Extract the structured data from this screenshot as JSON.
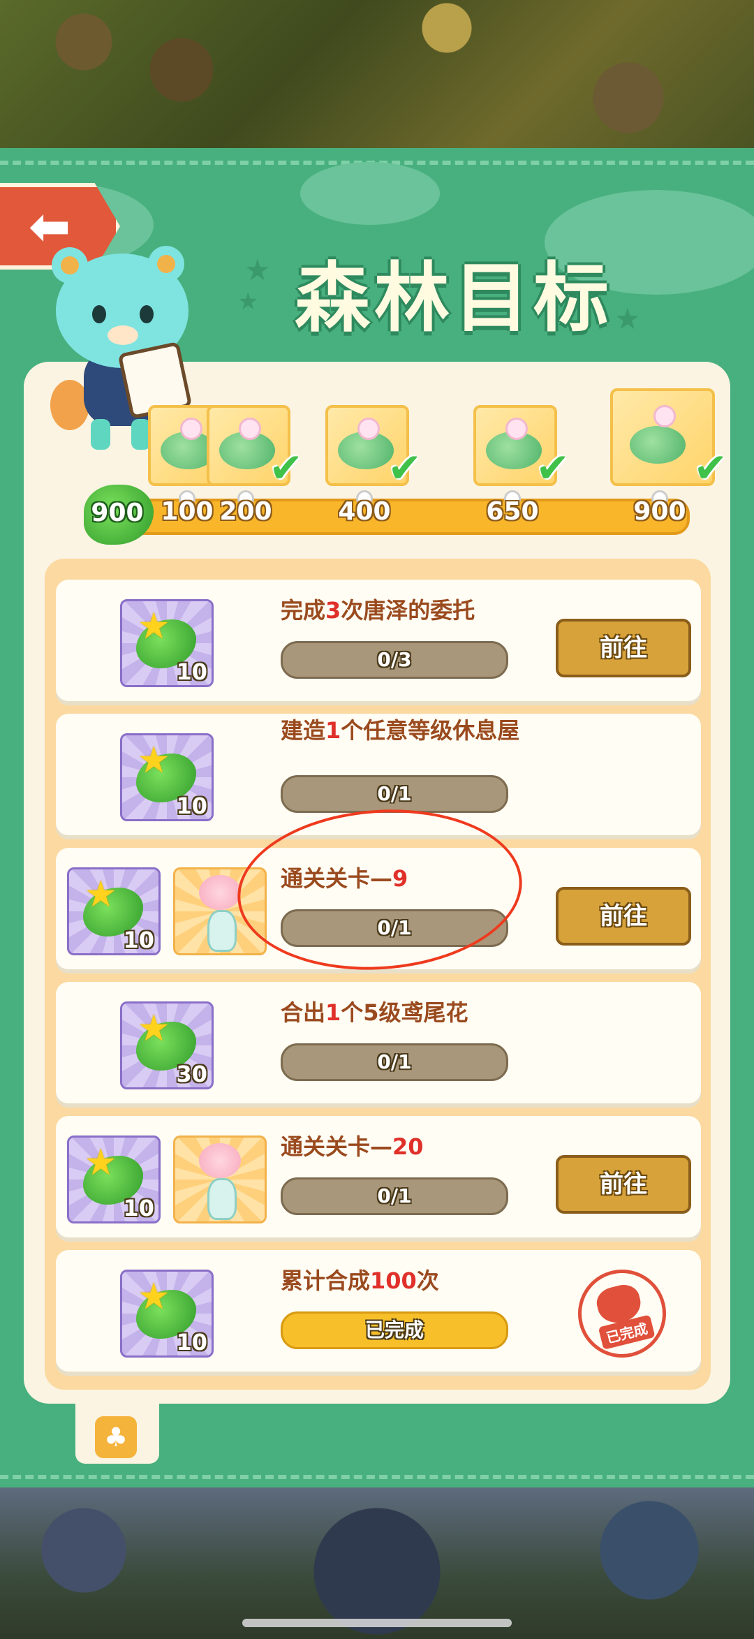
{
  "title": "森林目标",
  "leaf_score": "900",
  "milestones": [
    {
      "value": "100",
      "completed": false
    },
    {
      "value": "200",
      "completed": true
    },
    {
      "value": "400",
      "completed": true
    },
    {
      "value": "650",
      "completed": true
    },
    {
      "value": "900",
      "completed": true
    }
  ],
  "tasks": [
    {
      "text_before": "完成",
      "highlight": "3",
      "text_after": "次唐泽的委托",
      "progress": "0/3",
      "action": "前往",
      "rewards": [
        {
          "type": "leaf",
          "qty": "10"
        }
      ]
    },
    {
      "text_before": "建造",
      "highlight": "1",
      "text_after": "个任意等级休息屋",
      "progress": "0/1",
      "action": "",
      "rewards": [
        {
          "type": "leaf",
          "qty": "10"
        }
      ]
    },
    {
      "text_before": "通关关卡—",
      "highlight": "9",
      "text_after": "",
      "progress": "0/1",
      "action": "前往",
      "rewards": [
        {
          "type": "leaf",
          "qty": "10"
        },
        {
          "type": "vase",
          "qty": ""
        }
      ]
    },
    {
      "text_before": "合出",
      "highlight": "1",
      "text_after": "个5级鸢尾花",
      "progress": "0/1",
      "action": "",
      "rewards": [
        {
          "type": "leaf",
          "qty": "30"
        }
      ]
    },
    {
      "text_before": "通关关卡—",
      "highlight": "20",
      "text_after": "",
      "progress": "0/1",
      "action": "前往",
      "rewards": [
        {
          "type": "leaf",
          "qty": "10"
        },
        {
          "type": "vase",
          "qty": ""
        }
      ]
    },
    {
      "text_before": "累计合成",
      "highlight": "100",
      "text_after": "次",
      "progress": "已完成",
      "action": "",
      "stamp": "已完成",
      "rewards": [
        {
          "type": "leaf",
          "qty": "10"
        }
      ]
    }
  ],
  "colors": {
    "panel": "#48b07e",
    "card": "#fbf4e2",
    "highlight": "#e0302a",
    "task_text": "#9a4a1e",
    "go_button": "#d8a23a",
    "annotation": "#ee3a1e"
  },
  "icons": {
    "back": "left-arrow-icon",
    "reward_leaf": "leaf-star-icon",
    "reward_vase": "flower-vase-icon",
    "bottom_tab": "tree-card-icon"
  }
}
